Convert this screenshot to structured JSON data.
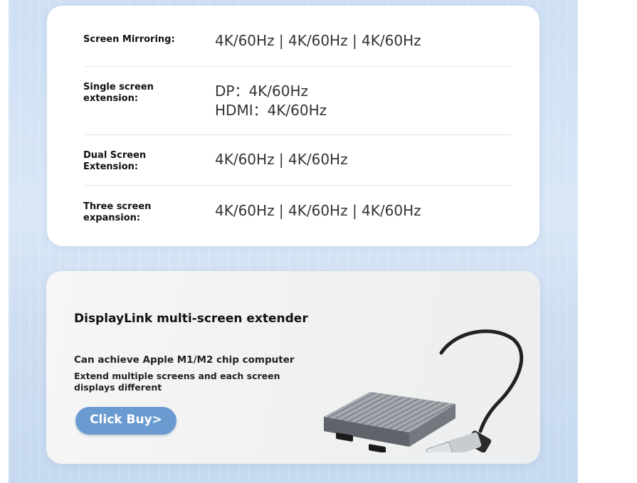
{
  "specs": {
    "rows": [
      {
        "label": "Screen Mirroring:",
        "value": "4K/60Hz | 4K/60Hz | 4K/60Hz"
      },
      {
        "label": "Single screen\nextension:",
        "value": "DP：4K/60Hz\nHDMI：4K/60Hz"
      },
      {
        "label": "Dual Screen\nExtension:",
        "value": "4K/60Hz | 4K/60Hz"
      },
      {
        "label": "Three screen\nexpansion:",
        "value": "4K/60Hz | 4K/60Hz | 4K/60Hz"
      }
    ]
  },
  "promo": {
    "title": "DisplayLink multi-screen extender",
    "line1": "Can achieve Apple M1/M2 chip computer",
    "line2": "Extend multiple screens and each screen displays different",
    "button_label": "Click Buy>",
    "product_image": "displaylink-usb-dual-hdmi-adapter-with-usb-c-dongle"
  },
  "colors": {
    "background": "#cfe0f4",
    "card": "#ffffff",
    "button": "#6a9bd0",
    "button_text": "#ffffff"
  }
}
